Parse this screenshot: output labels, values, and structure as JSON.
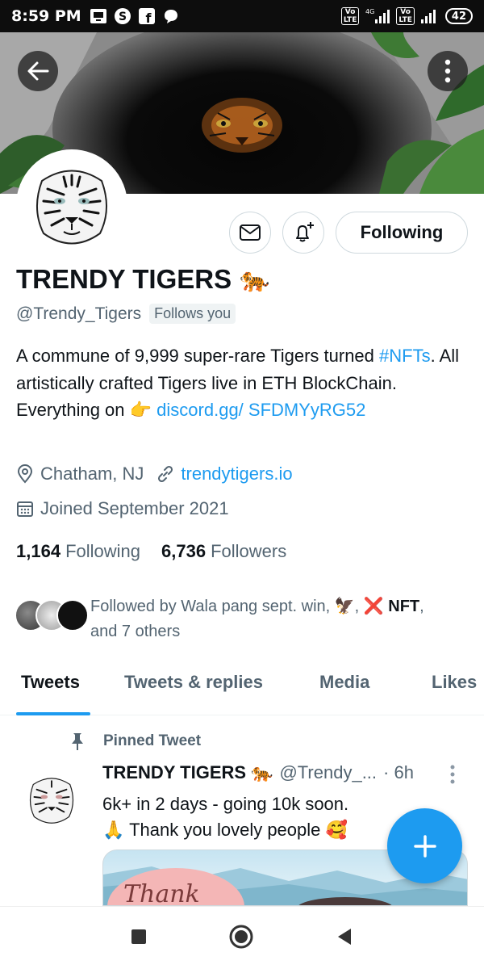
{
  "status_bar": {
    "time": "8:59 PM",
    "app_icons": [
      "screen-icon",
      "s-icon",
      "facebook-icon",
      "chat-icon"
    ],
    "network": "4G",
    "lte_label_1": "Vo\nLTE",
    "lte_label_2": "Vo\nLTE",
    "battery": "42"
  },
  "profile": {
    "name": "TRENDY TIGERS",
    "name_emoji": "🐅",
    "handle": "@Trendy_Tigers",
    "follows_you": "Follows you",
    "bio": {
      "part1": "A commune of 9,999 super-rare Tigers turned ",
      "hashtag": "#NFTs",
      "part2": ". All artistically crafted Tigers live in ETH BlockChain.  Everything on ",
      "pointer": "👉",
      "link": "discord.gg/ SFDMYyRG52"
    },
    "location": "Chatham, NJ",
    "website": "trendytigers.io",
    "joined": "Joined September 2021",
    "following_count": "1,164",
    "following_label": "Following",
    "followers_count": "6,736",
    "followers_label": "Followers",
    "followed_by": {
      "prefix": "Followed by Wala pang sept. win, ",
      "emoji1": "🦅",
      "sep": ", ",
      "emoji2": "❌",
      "nft": " NFT",
      "suffix": ",",
      "line2": "and 7 others"
    }
  },
  "actions": {
    "following_button": "Following"
  },
  "tabs": [
    {
      "label": "Tweets",
      "active": true
    },
    {
      "label": "Tweets & replies",
      "active": false
    },
    {
      "label": "Media",
      "active": false
    },
    {
      "label": "Likes",
      "active": false
    }
  ],
  "pinned_tweet": {
    "pinned_label": "Pinned Tweet",
    "author_name": "TRENDY TIGERS",
    "author_emoji": "🐅",
    "author_handle": "@Trendy_...",
    "time": "· 6h",
    "line1": "6k+ in 2 days - going 10k soon.",
    "line2_emoji": "🙏",
    "line2_text": " Thank you lovely people ",
    "line2_emoji2": "🥰",
    "image_text": "Thank"
  },
  "colors": {
    "accent": "#1d9bf0",
    "text": "#0f1419",
    "muted": "#536471",
    "border": "#cfd9de"
  }
}
